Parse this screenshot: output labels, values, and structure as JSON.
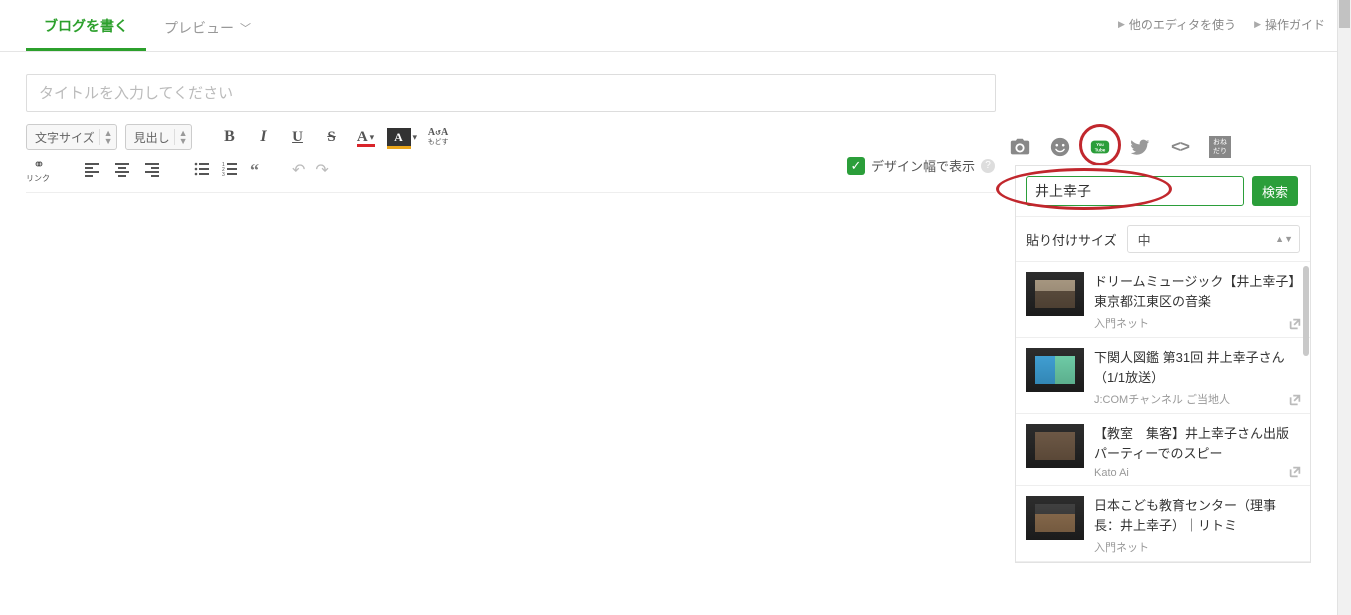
{
  "tabs": {
    "write": "ブログを書く",
    "preview": "プレビュー"
  },
  "top_links": {
    "other_editor": "他のエディタを使う",
    "guide": "操作ガイド"
  },
  "title_placeholder": "タイトルを入力してください",
  "toolbar": {
    "font_size": "文字サイズ",
    "heading": "見出し",
    "text_undo_label": "もどす",
    "link_label": "リンク"
  },
  "display_width": {
    "label": "デザイン幅で表示"
  },
  "insert_icons": {
    "camera": "camera",
    "emoji": "emoji",
    "youtube": "youtube",
    "twitter": "twitter",
    "embed": "embed",
    "onedari": "おね\nだり"
  },
  "youtube_panel": {
    "search_value": "井上幸子",
    "search_button": "検索",
    "size_label": "貼り付けサイズ",
    "size_value": "中",
    "results": [
      {
        "title": "ドリームミュージック【井上幸子】東京都江東区の音楽",
        "channel": "入門ネット"
      },
      {
        "title": "下関人図鑑 第31回 井上幸子さん（1/1放送）",
        "channel": "J:COMチャンネル ご当地人"
      },
      {
        "title": "【教室　集客】井上幸子さん出版パーティーでのスピー",
        "channel": "Kato Ai"
      },
      {
        "title": "日本こども教育センター（理事長：井上幸子）｜リトミ",
        "channel": "入門ネット"
      }
    ]
  }
}
